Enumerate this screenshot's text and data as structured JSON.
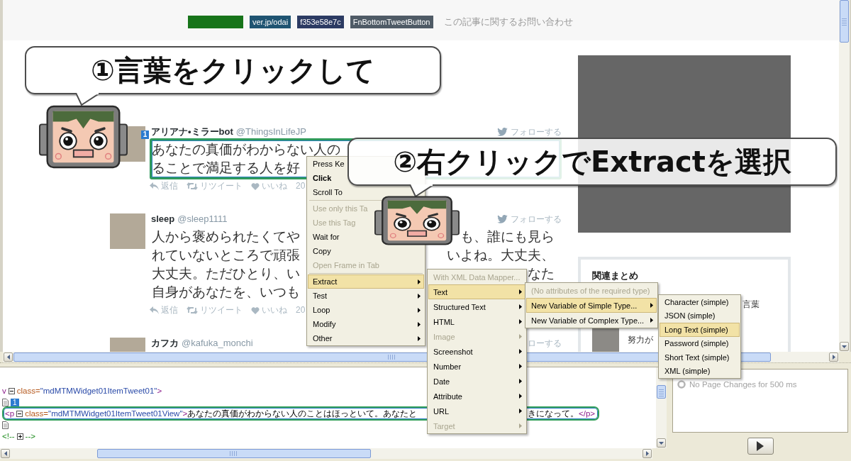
{
  "page": {
    "share_buttons": [
      {
        "color": "#17741a"
      },
      {
        "tag": "ver.jp/odai",
        "color": "#1f5472"
      },
      {
        "tag": "f353e58e7c",
        "color": "#2c3b63"
      },
      {
        "tag": "FnBottomTweetButton",
        "color": "#4f5b66"
      }
    ],
    "contact_link": "この記事に関するお問い合わせ",
    "tweets": [
      {
        "name": "アリアナ•ミラーbot",
        "handle": "@ThingsInLifeJP",
        "follow": "フォローする",
        "follow_icon": true,
        "selected": true,
        "badge": "1",
        "lines": [
          {
            "left": "あなたの真価がわからない人の"
          },
          {
            "left": "ることで満足する人を好"
          }
        ],
        "actions": [
          {
            "kind": "reply",
            "label": "返信"
          },
          {
            "kind": "retweet",
            "label": "リツイート"
          },
          {
            "kind": "like",
            "label": "いいね"
          },
          {
            "kind": "date",
            "label": "20"
          }
        ]
      },
      {
        "name": "sleep",
        "handle": "@sleep1111",
        "follow": "フォローする",
        "follow_icon": true,
        "selected": false,
        "lines": [
          {
            "left": "人から褒められたくてや",
            "right": "も、誰にも見ら"
          },
          {
            "left": "れていないところで頑張",
            "right": "いよね。大丈夫、"
          },
          {
            "left": "大丈夫。ただひとり、い",
            "right": "なた"
          },
          {
            "left": "自身があなたを、いつも"
          }
        ],
        "actions": [
          {
            "kind": "reply",
            "label": "返信"
          },
          {
            "kind": "retweet",
            "label": "リツイート"
          },
          {
            "kind": "like",
            "label": "いいね"
          },
          {
            "kind": "date",
            "label": "20"
          }
        ]
      },
      {
        "name": "カフカ",
        "handle": "@kafuka_monchi",
        "follow": "ローする",
        "follow_icon": false,
        "selected": false
      }
    ],
    "sidebar": {
      "title": "関連まとめ",
      "items": [
        {
          "title": "言葉",
          "thumbnail": false
        },
        {
          "title": "努力が",
          "thumbnail": true
        }
      ]
    }
  },
  "source_view": {
    "lines": [
      {
        "selected": false,
        "tokens": [
          {
            "kind": "tag",
            "text": "v"
          },
          {
            "kind": "collapse"
          },
          {
            "kind": "attr",
            "text": "class="
          },
          {
            "kind": "value",
            "text": "\"mdMTMWidget01ItemTweet01\""
          },
          {
            "kind": "tag",
            "text": ">"
          }
        ]
      },
      {
        "selected": false,
        "tokens": [
          {
            "kind": "doc"
          },
          {
            "kind": "badge",
            "text": "1"
          }
        ]
      },
      {
        "selected": true,
        "tokens": [
          {
            "kind": "tag",
            "text": "<p"
          },
          {
            "kind": "collapse"
          },
          {
            "kind": "attr",
            "text": "class="
          },
          {
            "kind": "value",
            "text": "\"mdMTMWidget01ItemTweet01View\""
          },
          {
            "kind": "tag",
            "text": ">"
          },
          {
            "kind": "text",
            "text": "あなたの真価がわからない人のことはほっといて。あなたと"
          }
        ],
        "tail": [
          {
            "kind": "text",
            "text": "きになって。"
          },
          {
            "kind": "tag",
            "text": "</p>"
          }
        ]
      },
      {
        "selected": false,
        "tokens": [
          {
            "kind": "doc"
          }
        ]
      },
      {
        "selected": false,
        "tokens": [
          {
            "kind": "comment",
            "text": "<!--"
          },
          {
            "kind": "expand"
          },
          {
            "kind": "comment",
            "text": "-->"
          }
        ]
      }
    ]
  },
  "changes_panel": {
    "status": "No Page Changes for 500 ms"
  },
  "menus": [
    {
      "items": [
        {
          "kind": "item",
          "label": "Press Ke",
          "default": false,
          "disabled": false,
          "selected": false,
          "submenu": false
        },
        {
          "kind": "item",
          "label": "Click",
          "default": true,
          "disabled": false,
          "selected": false,
          "submenu": false
        },
        {
          "kind": "item",
          "label": "Scroll To",
          "default": false,
          "disabled": false,
          "selected": false,
          "submenu": false
        },
        {
          "kind": "separator"
        },
        {
          "kind": "item",
          "label": "Use only this Ta",
          "default": false,
          "disabled": true,
          "selected": false,
          "submenu": false
        },
        {
          "kind": "item",
          "label": "Use this Tag",
          "default": false,
          "disabled": true,
          "selected": false,
          "submenu": false
        },
        {
          "kind": "item",
          "label": "Wait for",
          "default": false,
          "disabled": false,
          "selected": false,
          "submenu": false
        },
        {
          "kind": "item",
          "label": "Copy",
          "default": false,
          "disabled": false,
          "selected": false,
          "submenu": false
        },
        {
          "kind": "item",
          "label": "Open Frame in Tab",
          "default": false,
          "disabled": true,
          "selected": false,
          "submenu": false
        },
        {
          "kind": "separator"
        },
        {
          "kind": "item",
          "label": "Extract",
          "default": false,
          "disabled": false,
          "selected": true,
          "submenu": true
        },
        {
          "kind": "item",
          "label": "Test",
          "default": false,
          "disabled": false,
          "selected": false,
          "submenu": true
        },
        {
          "kind": "item",
          "label": "Loop",
          "default": false,
          "disabled": false,
          "selected": false,
          "submenu": true
        },
        {
          "kind": "item",
          "label": "Modify",
          "default": false,
          "disabled": false,
          "selected": false,
          "submenu": true
        },
        {
          "kind": "item",
          "label": "Other",
          "default": false,
          "disabled": false,
          "selected": false,
          "submenu": true
        }
      ]
    },
    {
      "items": [
        {
          "kind": "item",
          "label": "With XML Data Mapper...",
          "disabled": true,
          "selected": false,
          "submenu": false
        },
        {
          "kind": "item",
          "label": "Text",
          "disabled": false,
          "selected": true,
          "submenu": true
        },
        {
          "kind": "item",
          "label": "Structured Text",
          "disabled": false,
          "selected": false,
          "submenu": true
        },
        {
          "kind": "item",
          "label": "HTML",
          "disabled": false,
          "selected": false,
          "submenu": true
        },
        {
          "kind": "item",
          "label": "Image",
          "disabled": true,
          "selected": false,
          "submenu": true
        },
        {
          "kind": "item",
          "label": "Screenshot",
          "disabled": false,
          "selected": false,
          "submenu": true
        },
        {
          "kind": "item",
          "label": "Number",
          "disabled": false,
          "selected": false,
          "submenu": true
        },
        {
          "kind": "item",
          "label": "Date",
          "disabled": false,
          "selected": false,
          "submenu": true
        },
        {
          "kind": "item",
          "label": "Attribute",
          "disabled": false,
          "selected": false,
          "submenu": true
        },
        {
          "kind": "item",
          "label": "URL",
          "disabled": false,
          "selected": false,
          "submenu": true
        },
        {
          "kind": "item",
          "label": "Target",
          "disabled": true,
          "selected": false,
          "submenu": true
        }
      ]
    },
    {
      "items": [
        {
          "kind": "item",
          "label": "(No attributes of the required type)",
          "disabled": true,
          "selected": false,
          "submenu": false
        },
        {
          "kind": "item",
          "label": "New Variable of Simple Type...",
          "disabled": false,
          "selected": true,
          "submenu": true
        },
        {
          "kind": "item",
          "label": "New Variable of Complex Type...",
          "disabled": false,
          "selected": false,
          "submenu": true
        }
      ]
    },
    {
      "items": [
        {
          "kind": "item",
          "label": "Character (simple)",
          "disabled": false,
          "selected": false,
          "submenu": false
        },
        {
          "kind": "item",
          "label": "JSON (simple)",
          "disabled": false,
          "selected": false,
          "submenu": false
        },
        {
          "kind": "item",
          "label": "Long Text (simple)",
          "disabled": false,
          "selected": true,
          "submenu": false
        },
        {
          "kind": "item",
          "label": "Password (simple)",
          "disabled": false,
          "selected": false,
          "submenu": false
        },
        {
          "kind": "item",
          "label": "Short Text (simple)",
          "disabled": false,
          "selected": false,
          "submenu": false
        },
        {
          "kind": "item",
          "label": "XML (simple)",
          "disabled": false,
          "selected": false,
          "submenu": false
        }
      ]
    }
  ],
  "callouts": [
    {
      "text": "①言葉をクリックして"
    },
    {
      "text": "②右クリックでExtractを選択"
    }
  ]
}
